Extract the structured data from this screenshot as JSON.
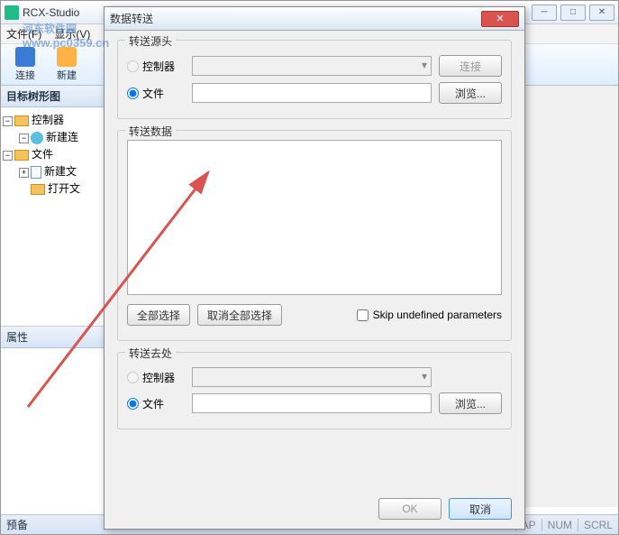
{
  "watermark": {
    "line1": "河东软件园",
    "line2": "www.pc0359.cn"
  },
  "main": {
    "title": "RCX-Studio",
    "menu": {
      "file": "文件(F)",
      "view": "显示(V)"
    },
    "ribbon": {
      "connect": "连接",
      "create": "新建"
    },
    "tree": {
      "title": "目标树形图",
      "controllers": "控制器",
      "new_conn": "新建连",
      "files": "文件",
      "new_file": "新建文",
      "open_file": "打开文"
    },
    "properties": {
      "title": "属性"
    },
    "status": {
      "ready": "预备",
      "cap": "AP",
      "num": "NUM",
      "scrl": "SCRL"
    }
  },
  "dialog": {
    "title": "数据转送",
    "source": {
      "group": "转送源头",
      "controller": "控制器",
      "file": "文件",
      "connect_btn": "连接",
      "browse_btn": "浏览..."
    },
    "data": {
      "group": "转送数据",
      "select_all": "全部选择",
      "deselect_all": "取消全部选择",
      "skip": "Skip undefined parameters"
    },
    "dest": {
      "group": "转送去处",
      "controller": "控制器",
      "file": "文件",
      "browse_btn": "浏览..."
    },
    "footer": {
      "ok": "OK",
      "cancel": "取消"
    }
  }
}
